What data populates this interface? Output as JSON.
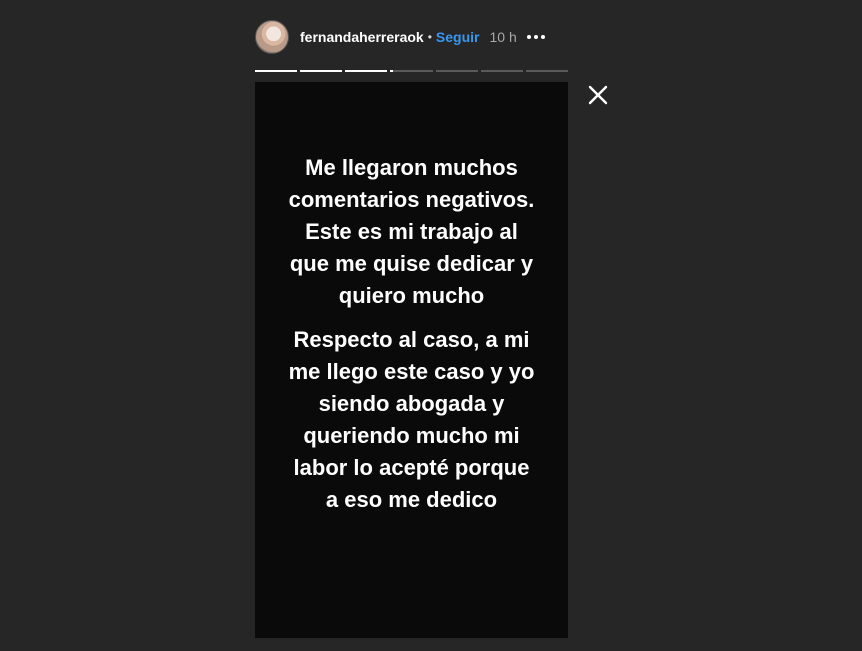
{
  "header": {
    "username": "fernandaherreraok",
    "separator": "•",
    "follow_label": "Seguir",
    "time": "10 h",
    "more_icon": "more-horizontal-icon",
    "avatar_icon": "profile-avatar"
  },
  "progress": {
    "segments": 7,
    "current_index": 3,
    "segment_fill": [
      1,
      1,
      1,
      0.05,
      0,
      0,
      0
    ]
  },
  "story": {
    "paragraph1": [
      "Me llegaron muchos",
      "comentarios negativos.",
      "Este es mi trabajo al",
      "que me quise dedicar y",
      "quiero mucho"
    ],
    "paragraph2": [
      "Respecto al caso, a mi",
      "me llego este caso y yo",
      "siendo abogada y",
      "queriendo mucho mi",
      "labor lo acepté porque",
      "a eso me dedico"
    ]
  },
  "controls": {
    "close_icon": "close-icon"
  },
  "colors": {
    "background": "#262626",
    "story_background": "#0a0a0a",
    "accent": "#3897f0",
    "time": "#a8a8a8"
  }
}
